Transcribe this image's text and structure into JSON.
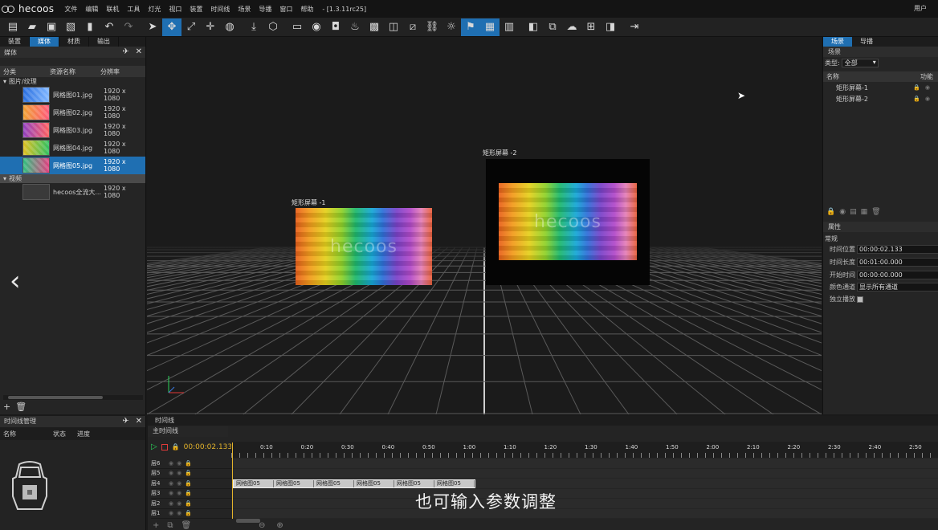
{
  "app": {
    "logo_text": "hecoos",
    "version": "- [1.3.11rc25]",
    "user_tag": "用户"
  },
  "menu": [
    "文件",
    "编辑",
    "联机",
    "工具",
    "灯光",
    "视口",
    "装置",
    "时间线",
    "场景",
    "导播",
    "窗口",
    "帮助"
  ],
  "left_panel": {
    "tabs": [
      "装置",
      "媒体",
      "材质",
      "输出"
    ],
    "active_tab": 1,
    "header": "媒体",
    "columns": [
      "分类",
      "资源名称",
      "分辨率"
    ],
    "group_images": "图片/纹理",
    "group_video": "视频",
    "assets": [
      {
        "name": "网格图01.jpg",
        "resolution": "1920 x 1080",
        "c1": "#2a6fe0",
        "c2": "#7fb6ff"
      },
      {
        "name": "网格图02.jpg",
        "resolution": "1920 x 1080",
        "c1": "#f0a030",
        "c2": "#ff5a7a"
      },
      {
        "name": "网格图03.jpg",
        "resolution": "1920 x 1080",
        "c1": "#9040c0",
        "c2": "#ff6060"
      },
      {
        "name": "网格图04.jpg",
        "resolution": "1920 x 1080",
        "c1": "#e0c020",
        "c2": "#30c060"
      },
      {
        "name": "网格图05.jpg",
        "resolution": "1920 x 1080",
        "c1": "#30c080",
        "c2": "#e04080",
        "selected": true
      }
    ],
    "video_asset": {
      "name": "hecoos全流大...",
      "resolution": "1920 x 1080"
    }
  },
  "viewport": {
    "screen1_label": "矩形屏幕 -1",
    "screen2_label": "矩形屏幕 -2",
    "watermark": "hecoos"
  },
  "right_panel": {
    "tabs": [
      "场景",
      "导播"
    ],
    "header": "场景",
    "type_label": "类型:",
    "type_value": "全部",
    "col_name": "名称",
    "col_func": "功能",
    "scenes": [
      "矩形屏幕-1",
      "矩形屏幕-2"
    ],
    "properties_header": "属性",
    "group_label": "常规",
    "properties": [
      {
        "label": "时间位置",
        "value": "00:00:02.133"
      },
      {
        "label": "时间长度",
        "value": "00:01:00.000"
      },
      {
        "label": "开始时间",
        "value": "00:00:00.000"
      },
      {
        "label": "颜色通道",
        "value": "显示所有通道"
      }
    ],
    "solo_label": "独立播放"
  },
  "timeline_manager": {
    "header": "时间线管理",
    "columns": [
      "名称",
      "状态",
      "进度"
    ]
  },
  "timeline": {
    "tab": "时间线",
    "sub": "主时间线",
    "current_time": "00:00:02.133",
    "ticks": [
      "0:10",
      "0:20",
      "0:30",
      "0:40",
      "0:50",
      "1:00",
      "1:10",
      "1:20",
      "1:30",
      "1:40",
      "1:50",
      "2:00",
      "2:10",
      "2:20",
      "2:30",
      "2:40",
      "2:50"
    ],
    "layers": [
      "层6",
      "层5",
      "层4",
      "层3",
      "层2",
      "层1"
    ],
    "clips": [
      "网格图05",
      "网格图05",
      "网格图05",
      "网格图05",
      "网格图05",
      "网格图05"
    ]
  },
  "subtitle": "也可输入参数调整",
  "colors": {
    "accent": "#1f6fb2",
    "playhead": "#e3b32b",
    "play": "#2bd15a"
  }
}
